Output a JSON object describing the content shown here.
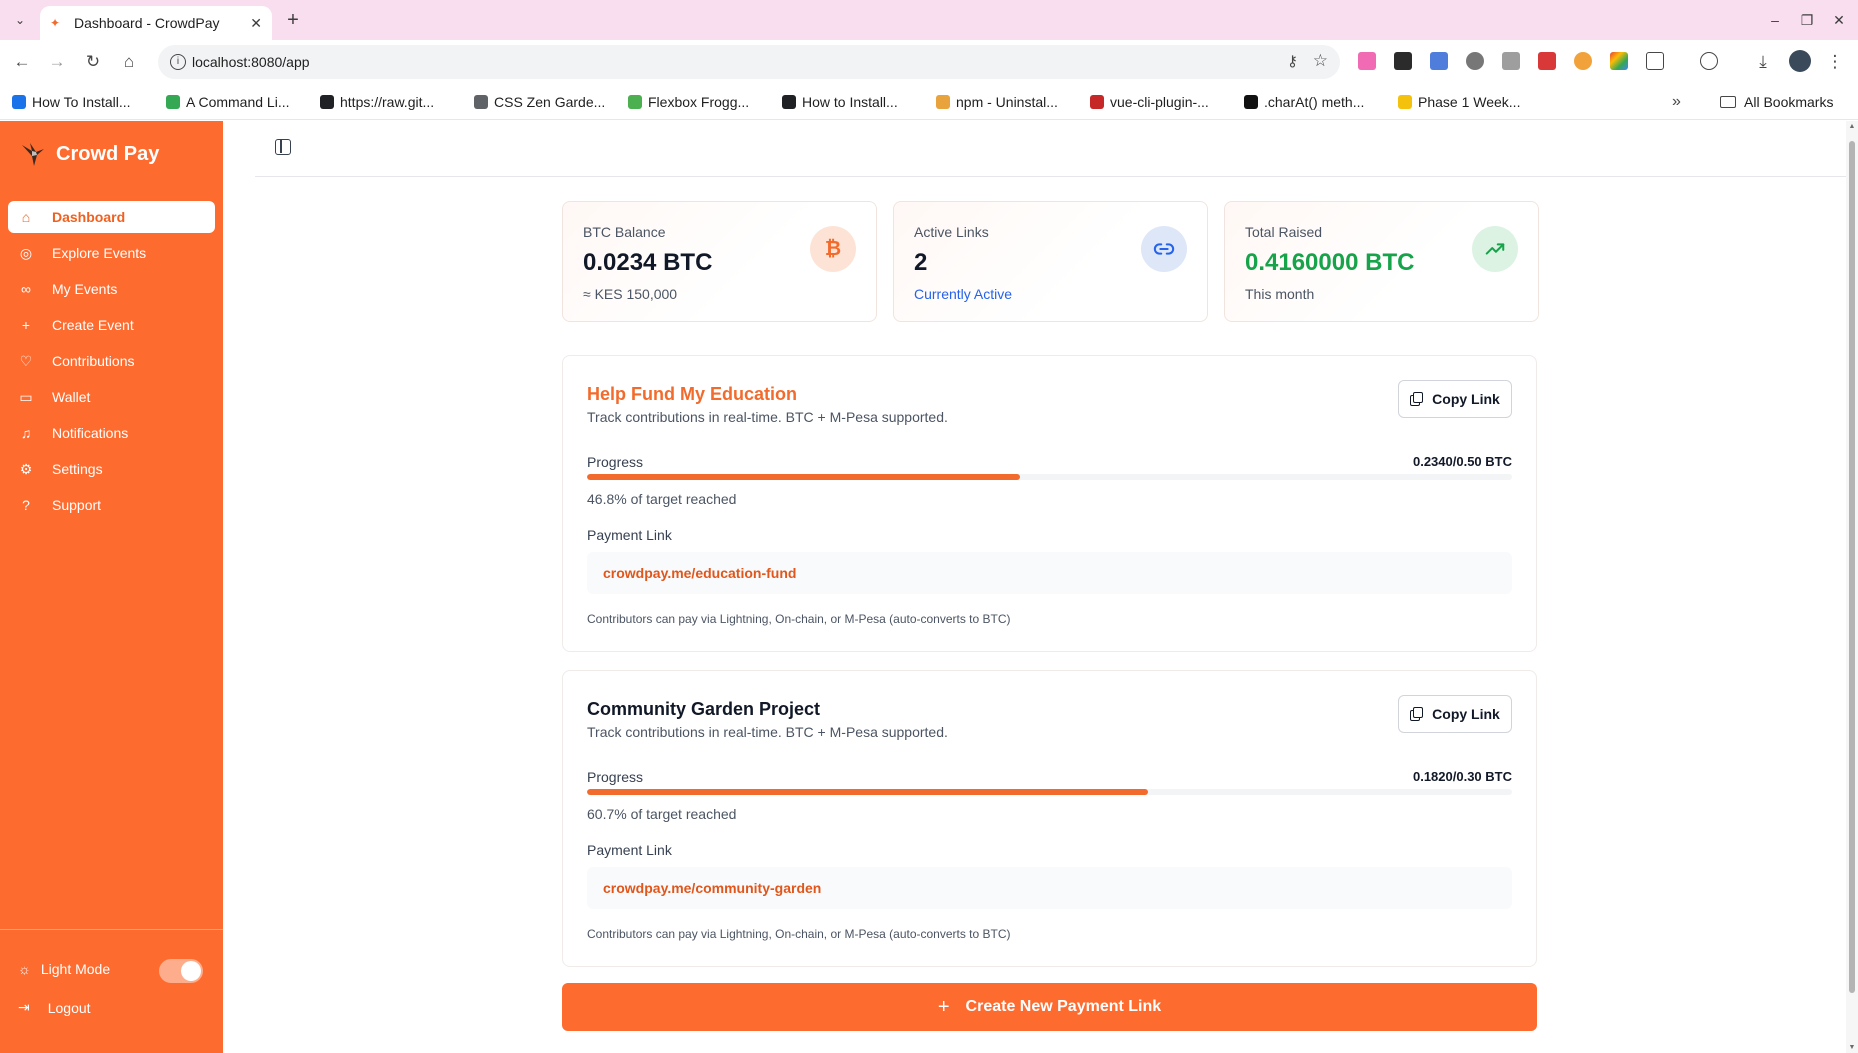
{
  "browser": {
    "tab_title": "Dashboard - CrowdPay",
    "url": "localhost:8080/app",
    "bookmarks": [
      {
        "label": "How To Install...",
        "color": "#1a73e8"
      },
      {
        "label": "A Command Li...",
        "color": "#34a853"
      },
      {
        "label": "https://raw.git...",
        "color": "#202124"
      },
      {
        "label": "CSS Zen Garde...",
        "color": "#5f6368"
      },
      {
        "label": "Flexbox Frogg...",
        "color": "#4caf50"
      },
      {
        "label": "How to Install...",
        "color": "#202124"
      },
      {
        "label": "npm - Uninstal...",
        "color": "#e8a33d"
      },
      {
        "label": "vue-cli-plugin-...",
        "color": "#c62828"
      },
      {
        "label": ".charAt() meth...",
        "color": "#111111"
      },
      {
        "label": "Phase 1 Week...",
        "color": "#f4c20d"
      }
    ],
    "all_bookmarks": "All Bookmarks"
  },
  "sidebar": {
    "brand": "Crowd Pay",
    "items": [
      {
        "label": "Dashboard",
        "icon": "home-icon",
        "active": true
      },
      {
        "label": "Explore Events",
        "icon": "compass-icon",
        "active": false
      },
      {
        "label": "My Events",
        "icon": "link-icon",
        "active": false
      },
      {
        "label": "Create Event",
        "icon": "plus-icon",
        "active": false
      },
      {
        "label": "Contributions",
        "icon": "heart-icon",
        "active": false
      },
      {
        "label": "Wallet",
        "icon": "wallet-icon",
        "active": false
      },
      {
        "label": "Notifications",
        "icon": "bell-icon",
        "active": false
      },
      {
        "label": "Settings",
        "icon": "gear-icon",
        "active": false
      },
      {
        "label": "Support",
        "icon": "help-icon",
        "active": false
      }
    ],
    "light_mode": "Light Mode",
    "light_mode_on": true,
    "logout": "Logout"
  },
  "stats": [
    {
      "label": "BTC Balance",
      "value": "0.0234 BTC",
      "sub": "≈ KES 150,000",
      "icon": "bitcoin-icon",
      "icon_glyph": "₿",
      "value_color": "#111827",
      "sub_color": "#4b5563",
      "icon_bg": "#fde3d6",
      "icon_color": "#f26b2d"
    },
    {
      "label": "Active Links",
      "value": "2",
      "sub": "Currently Active",
      "icon": "link-icon",
      "icon_glyph": "",
      "value_color": "#111827",
      "sub_color": "#2563eb",
      "icon_bg": "#dde7f7",
      "icon_color": "#2563eb"
    },
    {
      "label": "Total Raised",
      "value": "0.4160000 BTC",
      "sub": "This month",
      "icon": "trending-up-icon",
      "icon_glyph": "",
      "value_color": "#16a34a",
      "sub_color": "#4b5563",
      "icon_bg": "#dcf3e4",
      "icon_color": "#16a34a"
    }
  ],
  "events": [
    {
      "title": "Help Fund My Education",
      "title_color": "#f26b2d",
      "description": "Track contributions in real-time. BTC + M-Pesa supported.",
      "copy_label": "Copy Link",
      "progress_label": "Progress",
      "amount": "0.2340/0.50 BTC",
      "progress": 0.468,
      "progress_text": "46.8% of target reached",
      "payment_label": "Payment Link",
      "payment_link": "crowdpay.me/education-fund",
      "note": "Contributors can pay via Lightning, On-chain, or M-Pesa (auto-converts to BTC)"
    },
    {
      "title": "Community Garden Project",
      "title_color": "#111827",
      "description": "Track contributions in real-time. BTC + M-Pesa supported.",
      "copy_label": "Copy Link",
      "progress_label": "Progress",
      "amount": "0.1820/0.30 BTC",
      "progress": 0.607,
      "progress_text": "60.7% of target reached",
      "payment_label": "Payment Link",
      "payment_link": "crowdpay.me/community-garden",
      "note": "Contributors can pay via Lightning, On-chain, or M-Pesa (auto-converts to BTC)"
    }
  ],
  "create_button": "Create New Payment Link",
  "colors": {
    "accent": "#fd6b2f"
  }
}
